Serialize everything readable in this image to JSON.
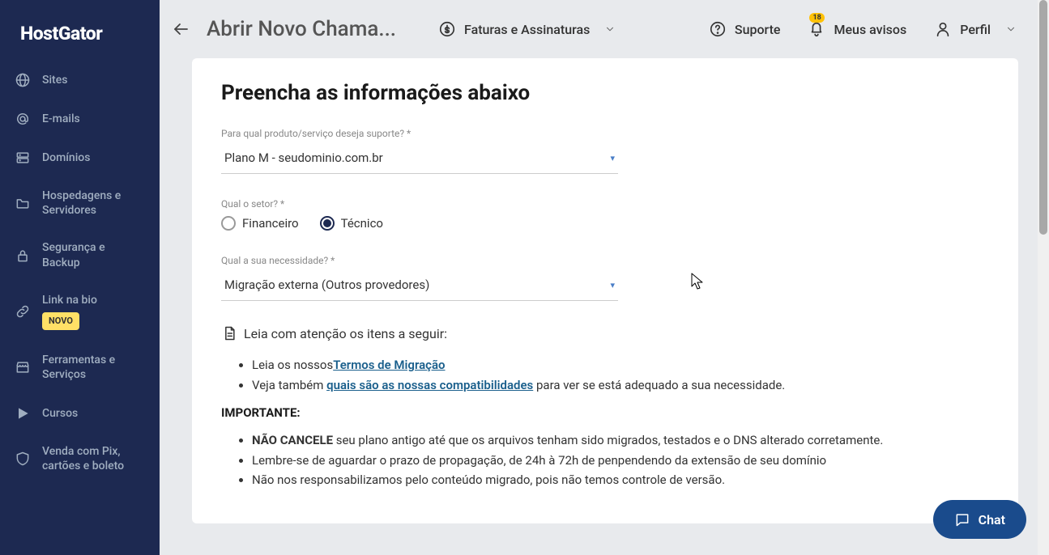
{
  "logo": "HostGator",
  "sidebar": {
    "items": [
      {
        "label": "Sites"
      },
      {
        "label": "E-mails"
      },
      {
        "label": "Domínios"
      },
      {
        "label": "Hospedagens e Servidores"
      },
      {
        "label": "Segurança e Backup"
      },
      {
        "label": "Link na bio",
        "badge": "NOVO"
      },
      {
        "label": "Ferramentas e Serviços"
      },
      {
        "label": "Cursos"
      },
      {
        "label": "Venda com Pix, cartões e boleto"
      }
    ]
  },
  "header": {
    "page_title": "Abrir Novo Chama...",
    "invoices": "Faturas e Assinaturas",
    "support": "Suporte",
    "notices": "Meus avisos",
    "notice_count": "18",
    "profile": "Perfil"
  },
  "form": {
    "title": "Preencha as informações abaixo",
    "product_label": "Para qual produto/serviço deseja suporte? *",
    "product_value": "Plano M - seudominio.com.br",
    "sector_label": "Qual o setor? *",
    "sector_financeiro": "Financeiro",
    "sector_tecnico": "Técnico",
    "need_label": "Qual a sua necessidade? *",
    "need_value": "Migração externa (Outros provedores)"
  },
  "info": {
    "heading": "Leia com atenção os itens a seguir:",
    "bullet1_pre": "Leia os nossos",
    "bullet1_link": "Termos de Migração",
    "bullet2_pre": "Veja também ",
    "bullet2_link": "quais são as nossas compatibilidades",
    "bullet2_post": " para ver se está adequado a sua necessidade.",
    "importante": "IMPORTANTE:",
    "imp1_strong": "NÃO CANCELE",
    "imp1_rest": " seu plano antigo até que os arquivos tenham sido migrados, testados e o DNS alterado corretamente.",
    "imp2": "Lembre-se de aguardar o prazo de propagação, de 24h à 72h de penpendendo da extensão de seu domínio",
    "imp3": "Não nos responsabilizamos pelo conteúdo migrado, pois não temos controle de versão."
  },
  "chat": {
    "label": "Chat"
  }
}
